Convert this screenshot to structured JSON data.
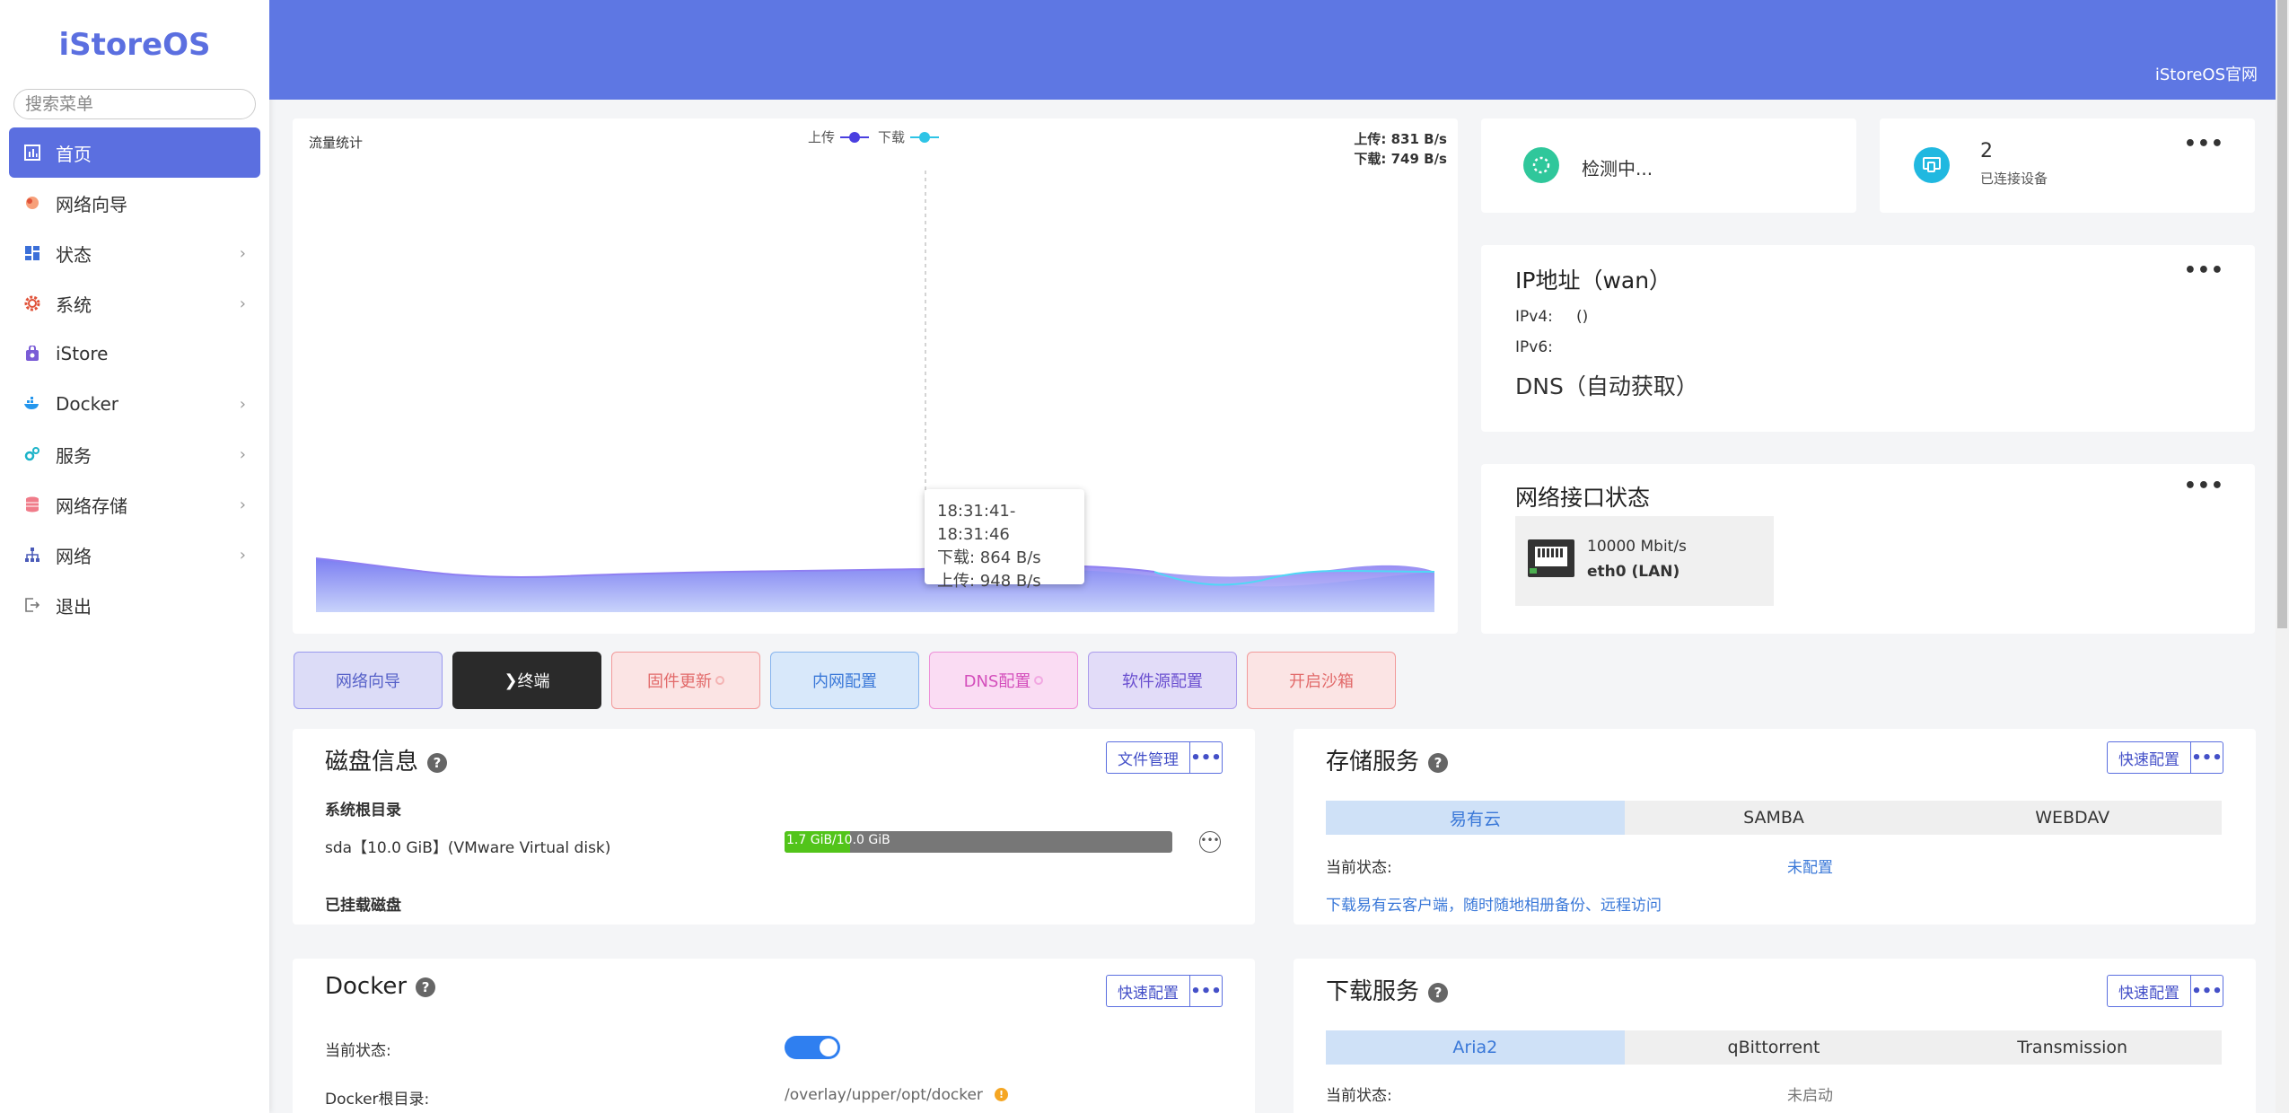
{
  "sidebar": {
    "logo": "iStoreOS",
    "search_placeholder": "搜索菜单",
    "items": [
      {
        "label": "首页"
      },
      {
        "label": "网络向导"
      },
      {
        "label": "状态"
      },
      {
        "label": "系统"
      },
      {
        "label": "iStore"
      },
      {
        "label": "Docker"
      },
      {
        "label": "服务"
      },
      {
        "label": "网络存储"
      },
      {
        "label": "网络"
      },
      {
        "label": "退出"
      }
    ]
  },
  "header": {
    "title": "iStoreOS官网"
  },
  "traffic": {
    "title": "流量统计",
    "legend_upload": "上传",
    "legend_download": "下载",
    "rate_upload": "上传: 831 B/s",
    "rate_download": "下载: 749 B/s",
    "tooltip_time": "18:31:41-18:31:46",
    "tooltip_download": "下载: 864 B/s",
    "tooltip_upload": "上传: 948 B/s"
  },
  "status": {
    "checking": "检测中...",
    "device_count": "2",
    "device_label": "已连接设备"
  },
  "ip": {
    "title": "IP地址（wan）",
    "ipv4_label": "IPv4:",
    "ipv4_value": "()",
    "ipv6_label": "IPv6:",
    "dns": "DNS（自动获取）"
  },
  "network": {
    "title": "网络接口状态",
    "speed": "10000 Mbit/s",
    "iface": "eth0 (LAN)"
  },
  "quick_buttons": [
    {
      "label": "网络向导"
    },
    {
      "label": "终端",
      "prefix": "❯"
    },
    {
      "label": "固件更新"
    },
    {
      "label": "内网配置"
    },
    {
      "label": "DNS配置"
    },
    {
      "label": "软件源配置"
    },
    {
      "label": "开启沙箱"
    }
  ],
  "disk": {
    "title": "磁盘信息",
    "manage_btn": "文件管理",
    "root_heading": "系统根目录",
    "disk_name": "sda【10.0 GiB】(VMware Virtual disk)",
    "usage_text": "1.7 GiB/10.0 GiB",
    "usage_fraction": 0.17,
    "mounted_heading": "已挂载磁盘"
  },
  "storage": {
    "title": "存储服务",
    "config_btn": "快速配置",
    "tabs": [
      "易有云",
      "SAMBA",
      "WEBDAV"
    ],
    "status_label": "当前状态:",
    "status_value": "未配置",
    "link": "下载易有云客户端，随时随地相册备份、远程访问"
  },
  "docker": {
    "title": "Docker",
    "config_btn": "快速配置",
    "status_label": "当前状态:",
    "toggle_on": true,
    "root_label": "Docker根目录:",
    "root_value": "/overlay/upper/opt/docker"
  },
  "download": {
    "title": "下载服务",
    "config_btn": "快速配置",
    "tabs": [
      "Aria2",
      "qBittorrent",
      "Transmission"
    ],
    "status_label": "当前状态:",
    "status_value": "未启动"
  }
}
